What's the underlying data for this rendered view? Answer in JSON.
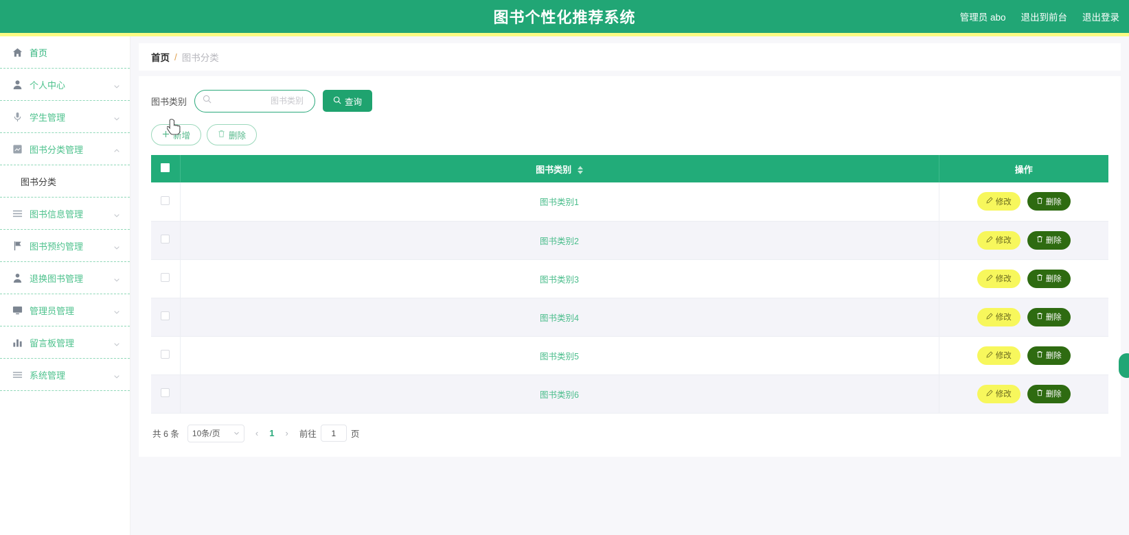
{
  "header": {
    "title": "图书个性化推荐系统",
    "user": "管理员 abo",
    "exit_front": "退出到前台",
    "logout": "退出登录",
    "bg_color": "#21a675",
    "strip_color": "#fbfb84"
  },
  "sidebar": {
    "items": [
      {
        "label": "首页",
        "icon": "home-icon",
        "expandable": false
      },
      {
        "label": "个人中心",
        "icon": "user-icon",
        "expandable": true,
        "expanded": false
      },
      {
        "label": "学生管理",
        "icon": "mic-icon",
        "expandable": true,
        "expanded": false
      },
      {
        "label": "图书分类管理",
        "icon": "grid-icon",
        "expandable": true,
        "expanded": true
      },
      {
        "label": "图书信息管理",
        "icon": "list-icon",
        "expandable": true,
        "expanded": false
      },
      {
        "label": "图书预约管理",
        "icon": "flag-icon",
        "expandable": true,
        "expanded": false
      },
      {
        "label": "退换图书管理",
        "icon": "person-icon",
        "expandable": true,
        "expanded": false
      },
      {
        "label": "管理员管理",
        "icon": "monitor-icon",
        "expandable": true,
        "expanded": false
      },
      {
        "label": "留言板管理",
        "icon": "chart-icon",
        "expandable": true,
        "expanded": false
      },
      {
        "label": "系统管理",
        "icon": "menu-icon",
        "expandable": true,
        "expanded": false
      }
    ],
    "sub_item": {
      "label": "图书分类",
      "active": true
    }
  },
  "breadcrumb": {
    "home": "首页",
    "separator": "/",
    "current": "图书分类"
  },
  "search": {
    "label": "图书类别",
    "placeholder": "图书类别",
    "value": "",
    "query_button": "查询",
    "query_icon": "search-icon"
  },
  "actions": {
    "add_label": "新增",
    "add_icon": "plus-icon",
    "delete_label": "删除",
    "delete_icon": "trash-icon"
  },
  "table": {
    "columns": [
      "",
      "图书类别",
      "操作"
    ],
    "sortable_column": "图书类别",
    "rows": [
      {
        "name": "图书类别1",
        "checked": false
      },
      {
        "name": "图书类别2",
        "checked": false
      },
      {
        "name": "图书类别3",
        "checked": false
      },
      {
        "name": "图书类别4",
        "checked": false
      },
      {
        "name": "图书类别5",
        "checked": false
      },
      {
        "name": "图书类别6",
        "checked": false
      }
    ],
    "row_edit_label": "修改",
    "row_delete_label": "删除",
    "header_bg": "#22ac79",
    "edit_color": "#f7f75c",
    "delete_color": "#2e6b11"
  },
  "pagination": {
    "total_text": "共 6 条",
    "page_size": "10条/页",
    "prev": "‹",
    "next": "›",
    "current_page": "1",
    "goto_label": "前往",
    "goto_value": "1",
    "goto_unit": "页"
  }
}
